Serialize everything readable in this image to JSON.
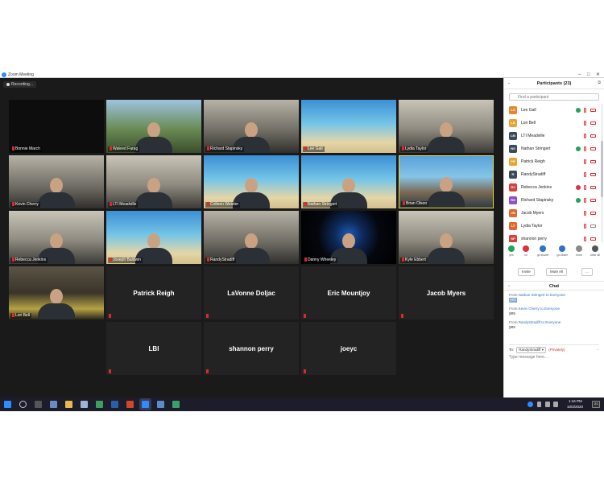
{
  "window": {
    "title": "Zoom Meeting",
    "minimize": "–",
    "maximize": "□",
    "close": "✕"
  },
  "recording": {
    "label": "Recording..."
  },
  "gallery": {
    "video_tiles": [
      {
        "name": "Bonnie March",
        "bg": "black"
      },
      {
        "name": "Waleed Farag",
        "bg": "outdoor"
      },
      {
        "name": "Richard Stapinsky",
        "bg": "room"
      },
      {
        "name": "Lee Gall",
        "bg": "beach"
      },
      {
        "name": "Lydia Taylor",
        "bg": "office"
      },
      {
        "name": "Kevin Cherry",
        "bg": "room"
      },
      {
        "name": "LTI Meadville",
        "bg": "office"
      },
      {
        "name": "Colleen Weister",
        "bg": "beach"
      },
      {
        "name": "Nathan Stringert",
        "bg": "beach"
      },
      {
        "name": "Brian Olson",
        "bg": "rocks",
        "active": true
      },
      {
        "name": "Rebecca Jenkins",
        "bg": "office"
      },
      {
        "name": "Joseph Baldwin",
        "bg": "beach"
      },
      {
        "name": "RandyStradiff",
        "bg": "room"
      },
      {
        "name": "Danny Wheeley",
        "bg": "dark"
      },
      {
        "name": "Kyle Ebbert",
        "bg": "office"
      },
      {
        "name": "Lori Bell",
        "bg": "yellow"
      }
    ],
    "name_tiles": [
      "Patrick Reigh",
      "LaVonne Doljac",
      "Eric Mountjoy",
      "Jacob Myers",
      "LBI",
      "shannon perry",
      "joeyc"
    ]
  },
  "participants": {
    "header": "Participants (23)",
    "search_placeholder": "Find a participant",
    "items": [
      {
        "initials": "LG",
        "name": "Lee Gall",
        "color": "#e8862e",
        "status": "check"
      },
      {
        "initials": "LB",
        "name": "Lori Bell",
        "color": "#f0a030",
        "status": ""
      },
      {
        "initials": "LM",
        "name": "LTI Meadville",
        "color": "#3b4a5a",
        "status": ""
      },
      {
        "initials": "NS",
        "name": "Nathan Stringert",
        "color": "#3b4a5a",
        "status": "check"
      },
      {
        "initials": "PR",
        "name": "Patrick Reigh",
        "color": "#f0a030",
        "status": ""
      },
      {
        "initials": "R",
        "name": "RandyStradiff",
        "color": "#3b4a5a",
        "status": ""
      },
      {
        "initials": "RJ",
        "name": "Rebecca Jenkins",
        "color": "#d8403a",
        "status": "x"
      },
      {
        "initials": "RS",
        "name": "Richard Stapinsky",
        "color": "#8e4fc9",
        "status": "check"
      },
      {
        "initials": "JM",
        "name": "Jacob Myers",
        "color": "#e06a2e",
        "status": ""
      },
      {
        "initials": "LT",
        "name": "Lydia Taylor",
        "color": "#e06a2e",
        "status": ""
      },
      {
        "initials": "SP",
        "name": "shannon perry",
        "color": "#d8403a",
        "status": ""
      }
    ],
    "reactions": [
      {
        "label": "yes",
        "color": "#23a35a"
      },
      {
        "label": "no",
        "color": "#e0303a"
      },
      {
        "label": "go slower",
        "color": "#2d73c7"
      },
      {
        "label": "go faster",
        "color": "#2d73c7"
      },
      {
        "label": "more",
        "color": "#8a8a8a"
      },
      {
        "label": "clear all",
        "color": "#555555"
      }
    ],
    "invite": "Invite",
    "mute_all": "Mute All",
    "more": "..."
  },
  "chat": {
    "header": "Chat",
    "messages": [
      {
        "from_prefix": "From",
        "sender": "Nathan Stringert",
        "to": "to Everyone",
        "text": "yes",
        "highlight": true
      },
      {
        "from_prefix": "From",
        "sender": "Kevin Cherry",
        "to": "to Everyone",
        "text": "yes",
        "highlight": false
      },
      {
        "from_prefix": "From",
        "sender": "RandyStradiff",
        "to": "to Everyone",
        "text": "yes",
        "highlight": false
      }
    ],
    "to_label": "To:",
    "to_value": "RandyStradiff",
    "privately": "(Privately)",
    "more": "...",
    "input_placeholder": "Type message here..."
  },
  "taskbar": {
    "time": "1:44 PM",
    "date": "10/3/2020",
    "notif": "21"
  }
}
